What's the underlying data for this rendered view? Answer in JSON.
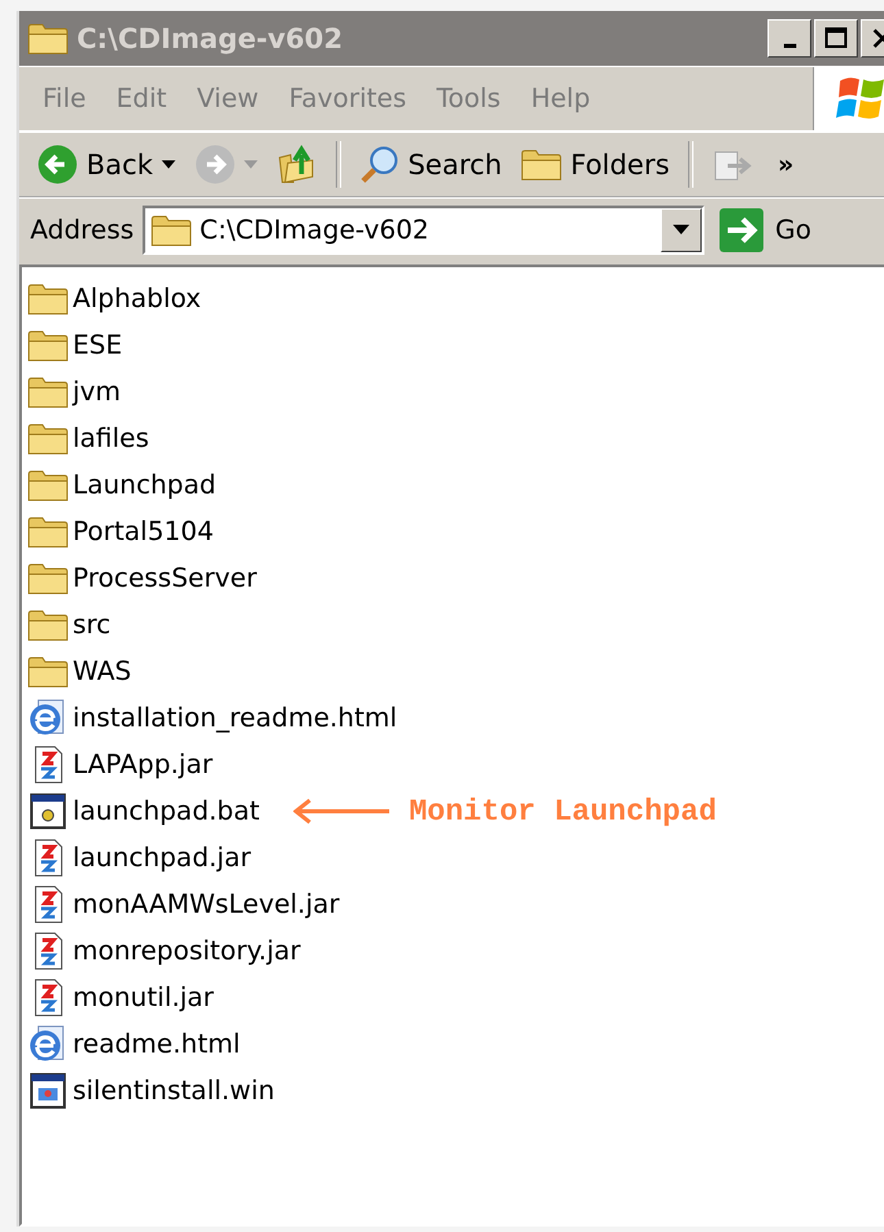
{
  "window": {
    "title": "C:\\CDImage-v602",
    "active": false
  },
  "menu": [
    "File",
    "Edit",
    "View",
    "Favorites",
    "Tools",
    "Help"
  ],
  "toolbar": {
    "back": {
      "label": "Back",
      "disabled": false
    },
    "forward": {
      "disabled": true
    },
    "search": {
      "label": "Search"
    },
    "folders": {
      "label": "Folders"
    },
    "overflow": "»"
  },
  "address": {
    "label": "Address",
    "value": "C:\\CDImage-v602",
    "go": "Go"
  },
  "files": [
    {
      "name": "Alphablox",
      "kind": "folder"
    },
    {
      "name": "ESE",
      "kind": "folder"
    },
    {
      "name": "jvm",
      "kind": "folder"
    },
    {
      "name": "lafiles",
      "kind": "folder"
    },
    {
      "name": "Launchpad",
      "kind": "folder"
    },
    {
      "name": "Portal5104",
      "kind": "folder"
    },
    {
      "name": "ProcessServer",
      "kind": "folder"
    },
    {
      "name": "src",
      "kind": "folder"
    },
    {
      "name": "WAS",
      "kind": "folder"
    },
    {
      "name": "installation_readme.html",
      "kind": "html"
    },
    {
      "name": "LAPApp.jar",
      "kind": "jar"
    },
    {
      "name": "launchpad.bat",
      "kind": "bat",
      "annotation": "Monitor Launchpad"
    },
    {
      "name": "launchpad.jar",
      "kind": "jar"
    },
    {
      "name": "monAAMWsLevel.jar",
      "kind": "jar"
    },
    {
      "name": "monrepository.jar",
      "kind": "jar"
    },
    {
      "name": "monutil.jar",
      "kind": "jar"
    },
    {
      "name": "readme.html",
      "kind": "html"
    },
    {
      "name": "silentinstall.win",
      "kind": "win"
    }
  ]
}
